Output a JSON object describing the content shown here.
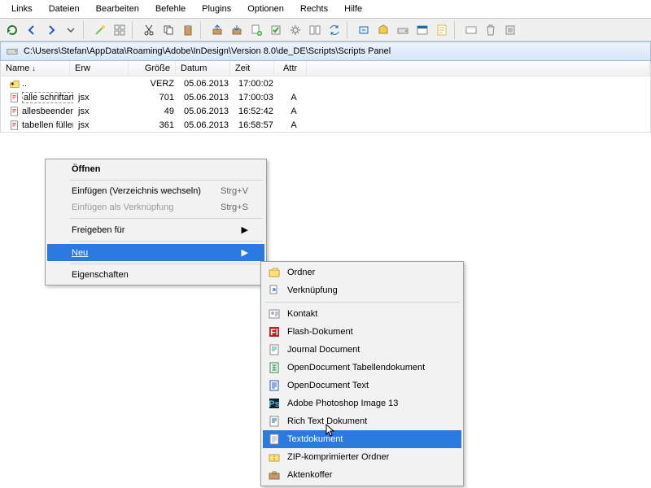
{
  "menubar": [
    "Links",
    "Dateien",
    "Bearbeiten",
    "Befehle",
    "Plugins",
    "Optionen",
    "Rechts",
    "Hilfe"
  ],
  "pathbar": {
    "path": "C:\\Users\\Stefan\\AppData\\Roaming\\Adobe\\InDesign\\Version 8.0\\de_DE\\Scripts\\Scripts Panel"
  },
  "columns": {
    "name": "Name",
    "ext": "Erw",
    "size": "Größe",
    "date": "Datum",
    "time": "Zeit",
    "attr": "Attr"
  },
  "files": [
    {
      "icon": "updir",
      "name": "..",
      "ext": "",
      "size": "VERZ",
      "date": "05.06.2013",
      "time": "17:00:02",
      "attr": ""
    },
    {
      "icon": "jsx",
      "name": "alle schriftarten",
      "ext": "jsx",
      "size": "701",
      "date": "05.06.2013",
      "time": "17:00:03",
      "attr": "A",
      "selected": true
    },
    {
      "icon": "jsx",
      "name": "allesbeenden",
      "ext": "jsx",
      "size": "49",
      "date": "05.06.2013",
      "time": "16:52:42",
      "attr": "A"
    },
    {
      "icon": "jsx",
      "name": "tabellen füllen",
      "ext": "jsx",
      "size": "361",
      "date": "05.06.2013",
      "time": "16:58:57",
      "attr": "A"
    }
  ],
  "ctx": {
    "open": "Öffnen",
    "paste": "Einfügen (Verzeichnis wechseln)",
    "paste_shortcut": "Strg+V",
    "paste_link": "Einfügen als Verknüpfung",
    "paste_link_shortcut": "Strg+S",
    "share": "Freigeben für",
    "neu": "Neu",
    "props": "Eigenschaften"
  },
  "submenu": [
    {
      "icon": "folder",
      "label": "Ordner"
    },
    {
      "icon": "link",
      "label": "Verknüpfung"
    },
    {
      "sep": true
    },
    {
      "icon": "contact",
      "label": "Kontakt"
    },
    {
      "icon": "flash",
      "label": "Flash-Dokument"
    },
    {
      "icon": "journal",
      "label": "Journal Document"
    },
    {
      "icon": "ods",
      "label": "OpenDocument Tabellendokument"
    },
    {
      "icon": "odt",
      "label": "OpenDocument Text"
    },
    {
      "icon": "psd",
      "label": "Adobe Photoshop Image 13"
    },
    {
      "icon": "rtf",
      "label": "Rich Text Dokument"
    },
    {
      "icon": "txt",
      "label": "Textdokument",
      "highlighted": true
    },
    {
      "icon": "zip",
      "label": "ZIP-komprimierter Ordner"
    },
    {
      "icon": "briefcase",
      "label": "Aktenkoffer"
    }
  ]
}
